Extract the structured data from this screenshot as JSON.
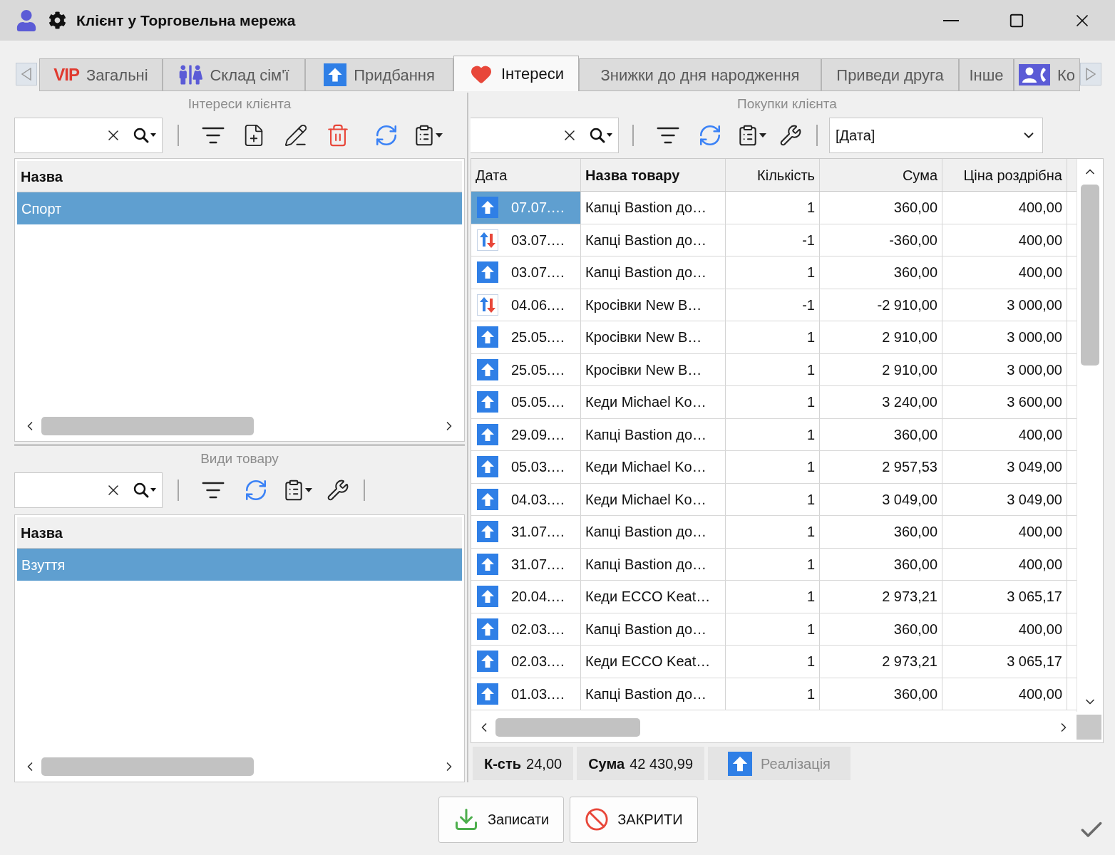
{
  "window": {
    "title": "Клієнт у Торговельна мережа"
  },
  "tabs": [
    {
      "badge": "VIP",
      "label": "Загальні",
      "selected": false
    },
    {
      "label": "Склад сім'ї",
      "selected": false
    },
    {
      "label": "Придбання",
      "selected": false
    },
    {
      "label": "Інтереси",
      "selected": true
    },
    {
      "label": "Знижки до дня народження",
      "selected": false
    },
    {
      "label": "Приведи друга",
      "selected": false
    },
    {
      "label": "Інше",
      "selected": false
    },
    {
      "label": "Ко",
      "selected": false
    }
  ],
  "interests_panel": {
    "title": "Інтереси клієнта",
    "table": {
      "columns": [
        {
          "label": "Назва",
          "highlighted": true
        }
      ],
      "rows": [
        {
          "cells": [
            "Спорт"
          ],
          "selected": true
        }
      ]
    }
  },
  "product_types_panel": {
    "title": "Види товару",
    "table": {
      "columns": [
        {
          "label": "Назва",
          "highlighted": true
        }
      ],
      "rows": [
        {
          "cells": [
            "Взуття"
          ],
          "selected": true
        }
      ]
    }
  },
  "purchases_panel": {
    "title": "Покупки клієнта",
    "sort_field": {
      "value": "[Дата]"
    },
    "table": {
      "columns": [
        {
          "label": "Дата",
          "kind": "date",
          "highlighted": false
        },
        {
          "label": "Назва товару",
          "kind": "text",
          "highlighted": true
        },
        {
          "label": "Кількість",
          "kind": "number",
          "highlighted": false
        },
        {
          "label": "Сума",
          "kind": "number",
          "highlighted": false
        },
        {
          "label": "Ціна роздрібна",
          "kind": "number",
          "highlighted": false
        }
      ],
      "rows": [
        {
          "kind": "sale",
          "selected": true,
          "cells": [
            "07.07.…",
            "Капці Bastion до…",
            "1",
            "360,00",
            "400,00"
          ]
        },
        {
          "kind": "return",
          "selected": false,
          "cells": [
            "03.07.…",
            "Капці Bastion до…",
            "-1",
            "-360,00",
            "400,00"
          ]
        },
        {
          "kind": "sale",
          "selected": false,
          "cells": [
            "03.07.…",
            "Капці Bastion до…",
            "1",
            "360,00",
            "400,00"
          ]
        },
        {
          "kind": "return",
          "selected": false,
          "cells": [
            "04.06.…",
            "Кросівки New B…",
            "-1",
            "-2 910,00",
            "3 000,00"
          ]
        },
        {
          "kind": "sale",
          "selected": false,
          "cells": [
            "25.05.…",
            "Кросівки New B…",
            "1",
            "2 910,00",
            "3 000,00"
          ]
        },
        {
          "kind": "sale",
          "selected": false,
          "cells": [
            "25.05.…",
            "Кросівки New B…",
            "1",
            "2 910,00",
            "3 000,00"
          ]
        },
        {
          "kind": "sale",
          "selected": false,
          "cells": [
            "05.05.…",
            "Кеди Michael Ko…",
            "1",
            "3 240,00",
            "3 600,00"
          ]
        },
        {
          "kind": "sale",
          "selected": false,
          "cells": [
            "29.09.…",
            "Капці Bastion до…",
            "1",
            "360,00",
            "400,00"
          ]
        },
        {
          "kind": "sale",
          "selected": false,
          "cells": [
            "05.03.…",
            "Кеди Michael Ko…",
            "1",
            "2 957,53",
            "3 049,00"
          ]
        },
        {
          "kind": "sale",
          "selected": false,
          "cells": [
            "04.03.…",
            "Кеди Michael Ko…",
            "1",
            "3 049,00",
            "3 049,00"
          ]
        },
        {
          "kind": "sale",
          "selected": false,
          "cells": [
            "31.07.…",
            "Капці Bastion до…",
            "1",
            "360,00",
            "400,00"
          ]
        },
        {
          "kind": "sale",
          "selected": false,
          "cells": [
            "31.07.…",
            "Капці Bastion до…",
            "1",
            "360,00",
            "400,00"
          ]
        },
        {
          "kind": "sale",
          "selected": false,
          "cells": [
            "20.04.…",
            "Кеди ECCO Keat…",
            "1",
            "2 973,21",
            "3 065,17"
          ]
        },
        {
          "kind": "sale",
          "selected": false,
          "cells": [
            "02.03.…",
            "Капці Bastion до…",
            "1",
            "360,00",
            "400,00"
          ]
        },
        {
          "kind": "sale",
          "selected": false,
          "cells": [
            "02.03.…",
            "Кеди ECCO Keat…",
            "1",
            "2 973,21",
            "3 065,17"
          ]
        },
        {
          "kind": "sale",
          "selected": false,
          "cells": [
            "01.03.…",
            "Капці Bastion до…",
            "1",
            "360,00",
            "400,00"
          ]
        }
      ]
    },
    "summary": [
      {
        "label": "К-сть",
        "value": "24,00"
      },
      {
        "label": "Сума",
        "value": "42 430,99"
      }
    ],
    "filter_button": {
      "label": "Реалізація",
      "active": false
    }
  },
  "buttons": [
    {
      "kind": "save",
      "label": "Записати"
    },
    {
      "kind": "close",
      "label": "ЗАКРИТИ"
    }
  ]
}
